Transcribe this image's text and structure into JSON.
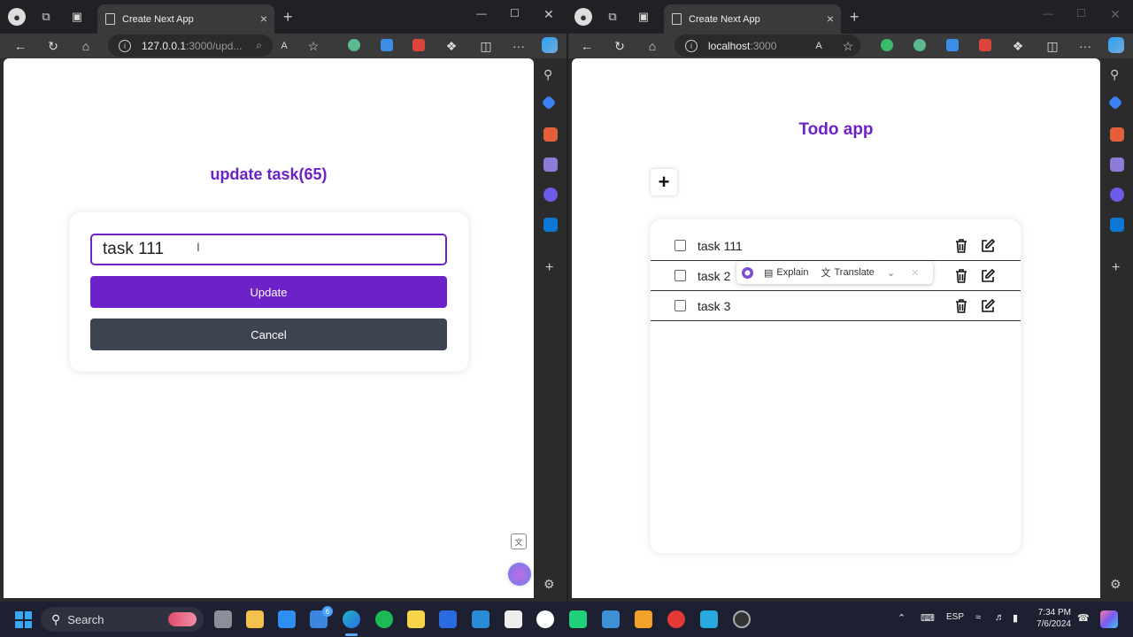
{
  "left_window": {
    "tab_title": "Create Next App",
    "url_host": "127.0.0.1",
    "url_path": ":3000/upd...",
    "page": {
      "heading": "update task(65)",
      "input_value": "task 111",
      "update_label": "Update",
      "cancel_label": "Cancel"
    }
  },
  "right_window": {
    "tab_title": "Create Next App",
    "url_host": "localhost",
    "url_path": ":3000",
    "page": {
      "heading": "Todo app",
      "add_label": "+",
      "tasks": [
        {
          "label": "task 111"
        },
        {
          "label": "task 2"
        },
        {
          "label": "task 3"
        }
      ],
      "selection_popup": {
        "explain": "Explain",
        "translate": "Translate"
      }
    }
  },
  "taskbar": {
    "search_label": "Search",
    "mail_badge": "6",
    "language": "ESP",
    "time": "7:34 PM",
    "date": "7/6/2024"
  },
  "colors": {
    "accent": "#6d22c9",
    "cancel": "#3d4451"
  }
}
